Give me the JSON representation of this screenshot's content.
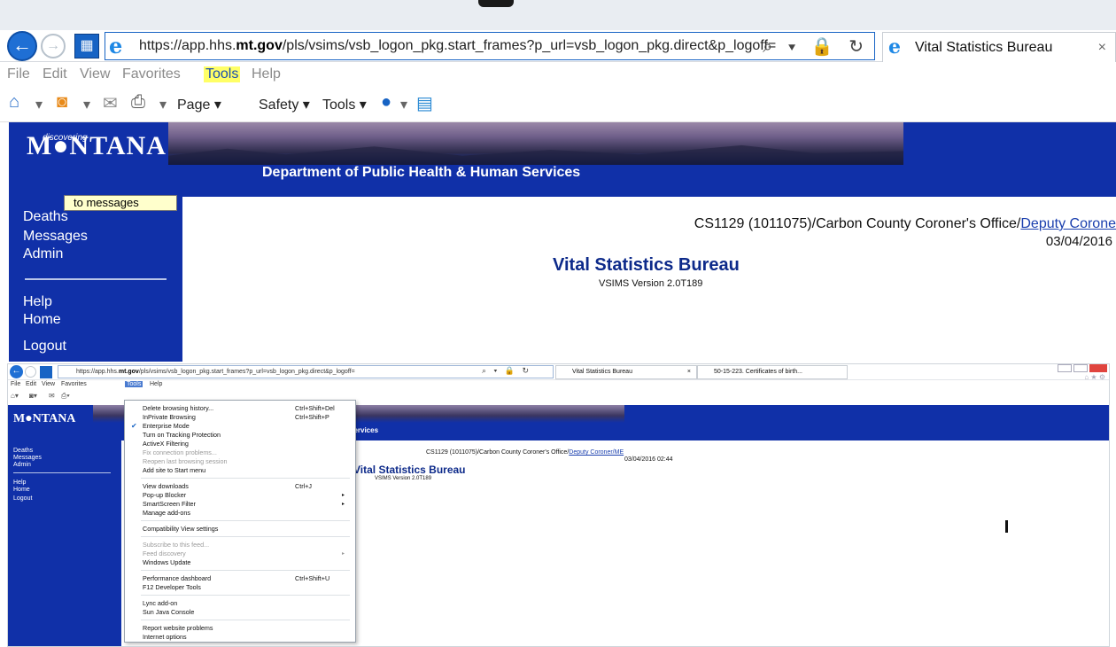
{
  "top": {
    "url_prefix": "https://app.hhs.",
    "url_bold": "mt.gov",
    "url_rest": "/pls/vsims/vsb_logon_pkg.start_frames?p_url=vsb_logon_pkg.direct&p_logoff=",
    "addr_controls": "⌕ ▾ 🔒 ↻",
    "tab_title": "Vital Statistics Bureau",
    "tab_close": "×",
    "menu": [
      "File",
      "Edit",
      "View",
      "Favorites",
      "Tools",
      "Help"
    ],
    "command": {
      "page": "Page ▾",
      "safety": "Safety ▾",
      "tools": "Tools ▾"
    },
    "banner": {
      "logo_small": "discovering",
      "logo": "M●NTANA",
      "dept": "Department of Public Health & Human Services"
    },
    "tooltip": "to messages",
    "nav": [
      "Deaths",
      "Messages",
      "Admin",
      "Help",
      "Home",
      "Logout"
    ],
    "user_line": "CS1129 (1011075)/Carbon County Coroner's Office/",
    "user_link": "Deputy Corone",
    "date": "03/04/2016",
    "bureau": "Vital Statistics Bureau",
    "version": "VSIMS Version 2.0T189"
  },
  "bottom": {
    "url_prefix": "https://app.hhs.",
    "url_bold": "mt.gov",
    "url_rest": "/pls/vsims/vsb_logon_pkg.start_frames?p_url=vsb_logon_pkg.direct&p_logoff=",
    "addr_controls": "⌕ ▾ 🔒 ↻",
    "tab1": "Vital Statistics Bureau",
    "tab1_close": "×",
    "tab2": "50-15-223. Certificates of birth...",
    "home_icons": "⌂ ★ ⚙",
    "menu": [
      "File",
      "Edit",
      "View",
      "Favorites",
      "Tools",
      "Help"
    ],
    "banner": {
      "logo": "M●NTANA",
      "dept": "n Services"
    },
    "nav": [
      "Deaths",
      "Messages",
      "Admin",
      "Help",
      "Home",
      "Logout"
    ],
    "user_line": "CS1129 (1011075)/Carbon County Coroner's Office/",
    "user_link": "Deputy Coroner/ME",
    "date": "03/04/2016 02:44",
    "bureau": "Vital Statistics Bureau",
    "version": "VSIMS Version 2.0T189"
  },
  "tools_menu": [
    {
      "label": "Delete browsing history...",
      "shortcut": "Ctrl+Shift+Del"
    },
    {
      "label": "InPrivate Browsing",
      "shortcut": "Ctrl+Shift+P"
    },
    {
      "label": "Enterprise Mode",
      "checked": true
    },
    {
      "label": "Turn on Tracking Protection"
    },
    {
      "label": "ActiveX Filtering"
    },
    {
      "label": "Fix connection problems...",
      "disabled": true
    },
    {
      "label": "Reopen last browsing session",
      "disabled": true
    },
    {
      "label": "Add site to Start menu"
    },
    {
      "label": "View downloads",
      "shortcut": "Ctrl+J"
    },
    {
      "label": "Pop-up Blocker",
      "submenu": true
    },
    {
      "label": "SmartScreen Filter",
      "submenu": true
    },
    {
      "label": "Manage add-ons"
    },
    {
      "label": "Compatibility View settings"
    },
    {
      "label": "Subscribe to this feed...",
      "disabled": true
    },
    {
      "label": "Feed discovery",
      "disabled": true,
      "submenu": true
    },
    {
      "label": "Windows Update"
    },
    {
      "label": "Performance dashboard",
      "shortcut": "Ctrl+Shift+U"
    },
    {
      "label": "F12 Developer Tools"
    },
    {
      "label": "Lync add-on"
    },
    {
      "label": "Sun Java Console"
    },
    {
      "label": "Report website problems"
    },
    {
      "label": "Internet options"
    }
  ],
  "colors": {
    "banner": "#1030a8",
    "highlight": "#ffff66",
    "link": "#1a3fae"
  }
}
